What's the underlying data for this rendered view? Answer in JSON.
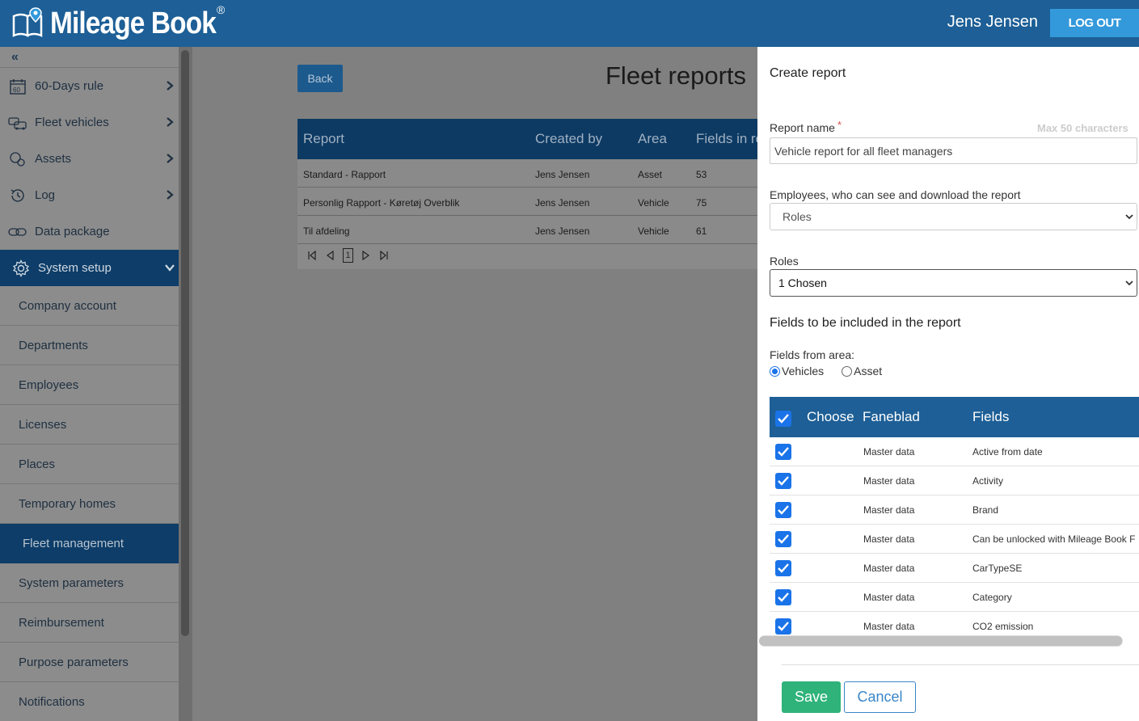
{
  "header": {
    "logo_text": "Mileage Book",
    "logo_reg": "®",
    "user_name": "Jens Jensen",
    "logout_label": "LOG OUT"
  },
  "sidebar": {
    "collapse_label": "«",
    "items": [
      {
        "label": "60-Days rule",
        "icon": "calendar-60-icon",
        "has_chevron": true
      },
      {
        "label": "Fleet vehicles",
        "icon": "fleet-vehicles-icon",
        "has_chevron": true
      },
      {
        "label": "Assets",
        "icon": "assets-icon",
        "has_chevron": true
      },
      {
        "label": "Log",
        "icon": "history-icon",
        "has_chevron": true
      },
      {
        "label": "Data package",
        "icon": "link-icon",
        "has_chevron": false
      },
      {
        "label": "System setup",
        "icon": "gear-icon",
        "has_chevron": true,
        "active": true
      }
    ],
    "sub_items": [
      {
        "label": "Company account"
      },
      {
        "label": "Departments"
      },
      {
        "label": "Employees"
      },
      {
        "label": "Licenses"
      },
      {
        "label": "Places"
      },
      {
        "label": "Temporary homes"
      },
      {
        "label": "Fleet management",
        "active": true
      },
      {
        "label": "System parameters"
      },
      {
        "label": "Reimbursement"
      },
      {
        "label": "Purpose parameters"
      },
      {
        "label": "Notifications"
      }
    ]
  },
  "main": {
    "back_label": "Back",
    "title": "Fleet reports",
    "table": {
      "columns": [
        "Report",
        "Created by",
        "Area",
        "Fields in re"
      ],
      "rows": [
        [
          "Standard - Rapport",
          "Jens Jensen",
          "Asset",
          "53"
        ],
        [
          "Personlig Rapport - Køretøj Overblik",
          "Jens Jensen",
          "Vehicle",
          "75"
        ],
        [
          "Til afdeling",
          "Jens Jensen",
          "Vehicle",
          "61"
        ]
      ]
    },
    "pager": {
      "current_page": "1"
    }
  },
  "panel": {
    "title": "Create report",
    "report_name_label": "Report name",
    "required_mark": "*",
    "max_hint": "Max 50 characters",
    "report_name_value": "Vehicle report for all fleet managers",
    "employees_label": "Employees, who can see and download the report",
    "employees_value": "Roles",
    "roles_label": "Roles",
    "roles_value": "1 Chosen",
    "fields_section_title": "Fields to be included in the report",
    "fields_from_label": "Fields from area:",
    "radio_vehicles": "Vehicles",
    "radio_asset": "Asset",
    "radio_selected": "Vehicles",
    "fields_table": {
      "columns": [
        "Choose",
        "Faneblad",
        "Fields"
      ],
      "rows": [
        {
          "checked": true,
          "faneblad": "Master data",
          "field": "Active from date"
        },
        {
          "checked": true,
          "faneblad": "Master data",
          "field": "Activity"
        },
        {
          "checked": true,
          "faneblad": "Master data",
          "field": "Brand"
        },
        {
          "checked": true,
          "faneblad": "Master data",
          "field": "Can be unlocked with Mileage Book F"
        },
        {
          "checked": true,
          "faneblad": "Master data",
          "field": "CarTypeSE"
        },
        {
          "checked": true,
          "faneblad": "Master data",
          "field": "Category"
        },
        {
          "checked": true,
          "faneblad": "Master data",
          "field": "CO2 emission"
        }
      ]
    },
    "save_label": "Save",
    "cancel_label": "Cancel"
  },
  "colors": {
    "header_blue": "#1d5f96",
    "logout_blue": "#3399db",
    "active_nav": "#0d3d68",
    "checkbox_blue": "#1a73e8",
    "save_green": "#2fb37a"
  }
}
